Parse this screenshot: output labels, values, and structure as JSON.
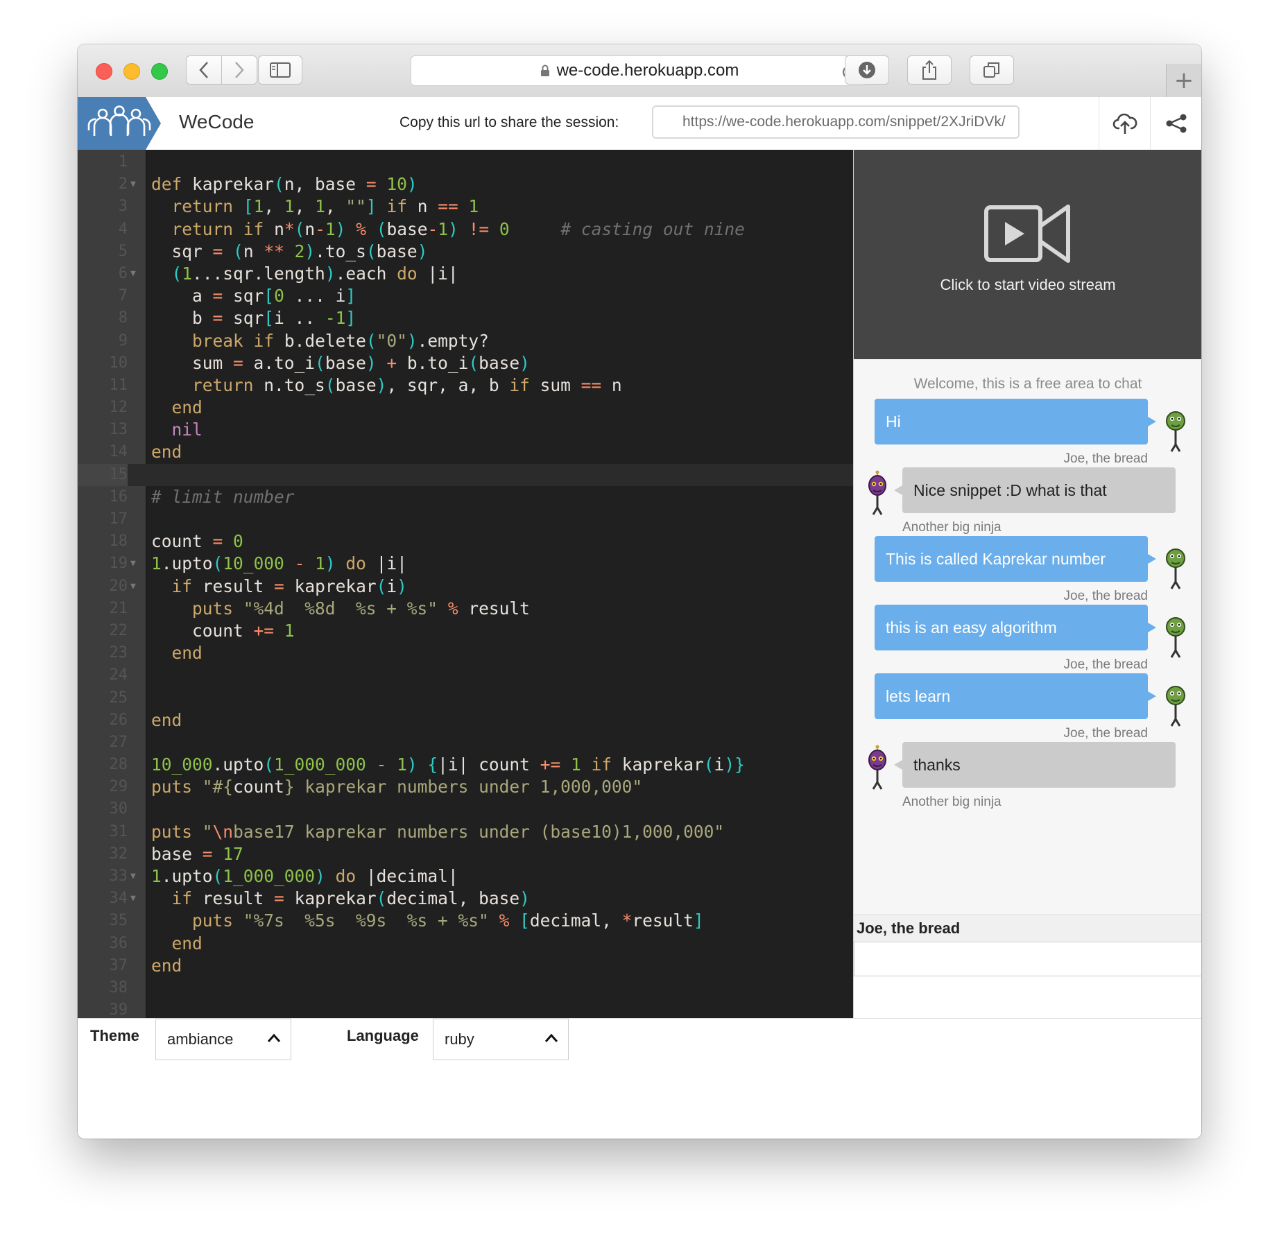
{
  "browser": {
    "url": "we-code.herokuapp.com",
    "new_tab_label": "+"
  },
  "header": {
    "app_name": "WeCode",
    "share_label": "Copy this url to share the session:",
    "share_url": "https://we-code.herokuapp.com/snippet/2XJriDVk/"
  },
  "editor": {
    "active_line": 15,
    "lines": [
      {
        "n": "1",
        "fold": false,
        "html": ""
      },
      {
        "n": "2",
        "fold": true,
        "html": "<span class='kw'>def</span> kaprekar<span class='br'>(</span>n, base <span class='op'>=</span> <span class='num'>10</span><span class='br'>)</span>"
      },
      {
        "n": "3",
        "fold": false,
        "html": "  <span class='kw'>return</span> <span class='br'>[</span><span class='num'>1</span>, <span class='num'>1</span>, <span class='num'>1</span>, <span class='str'>\"\"</span><span class='br'>]</span> <span class='kw'>if</span> n <span class='op'>==</span> <span class='num'>1</span>"
      },
      {
        "n": "4",
        "fold": false,
        "html": "  <span class='kw'>return</span> <span class='kw'>if</span> n<span class='op'>*</span><span class='br'>(</span>n<span class='op'>-</span><span class='num'>1</span><span class='br'>)</span> <span class='op'>%</span> <span class='br'>(</span>base<span class='op'>-</span><span class='num'>1</span><span class='br'>)</span> <span class='op'>!=</span> <span class='num'>0</span>     <span class='cm'># casting out nine</span>"
      },
      {
        "n": "5",
        "fold": false,
        "html": "  sqr <span class='op'>=</span> <span class='br'>(</span>n <span class='op'>**</span> <span class='num'>2</span><span class='br'>)</span>.to_s<span class='br'>(</span>base<span class='br'>)</span>"
      },
      {
        "n": "6",
        "fold": true,
        "html": "  <span class='br'>(</span><span class='num'>1</span>...sqr.length<span class='br'>)</span>.each <span class='kw'>do</span> |i|"
      },
      {
        "n": "7",
        "fold": false,
        "html": "    a <span class='op'>=</span> sqr<span class='br'>[</span><span class='num'>0</span> ... i<span class='br'>]</span>"
      },
      {
        "n": "8",
        "fold": false,
        "html": "    b <span class='op'>=</span> sqr<span class='br'>[</span>i .. <span class='num'>-1</span><span class='br'>]</span>"
      },
      {
        "n": "9",
        "fold": false,
        "html": "    <span class='kw'>break</span> <span class='kw'>if</span> b.delete<span class='br'>(</span><span class='str'>\"0\"</span><span class='br'>)</span>.empty?"
      },
      {
        "n": "10",
        "fold": false,
        "html": "    sum <span class='op'>=</span> a.to_i<span class='br'>(</span>base<span class='br'>)</span> <span class='op'>+</span> b.to_i<span class='br'>(</span>base<span class='br'>)</span>"
      },
      {
        "n": "11",
        "fold": false,
        "html": "    <span class='kw'>return</span> n.to_s<span class='br'>(</span>base<span class='br'>)</span>, sqr, a, b <span class='kw'>if</span> sum <span class='op'>==</span> n"
      },
      {
        "n": "12",
        "fold": false,
        "html": "  <span class='kw'>end</span>"
      },
      {
        "n": "13",
        "fold": false,
        "html": "  <span class='nl'>nil</span>"
      },
      {
        "n": "14",
        "fold": false,
        "html": "<span class='kw'>end</span>"
      },
      {
        "n": "15",
        "fold": false,
        "html": ""
      },
      {
        "n": "16",
        "fold": false,
        "html": "<span class='cm'># limit number</span>"
      },
      {
        "n": "17",
        "fold": false,
        "html": ""
      },
      {
        "n": "18",
        "fold": false,
        "html": "count <span class='op'>=</span> <span class='num'>0</span>"
      },
      {
        "n": "19",
        "fold": true,
        "html": "<span class='num'>1</span>.upto<span class='br'>(</span><span class='num'>10_000</span> <span class='op'>-</span> <span class='num'>1</span><span class='br'>)</span> <span class='kw'>do</span> |i|"
      },
      {
        "n": "20",
        "fold": true,
        "html": "  <span class='kw'>if</span> result <span class='op'>=</span> kaprekar<span class='br'>(</span>i<span class='br'>)</span>"
      },
      {
        "n": "21",
        "fold": false,
        "html": "    <span class='kw'>puts</span> <span class='str'>\"%4d  %8d  %s + %s\"</span> <span class='op'>%</span> result"
      },
      {
        "n": "22",
        "fold": false,
        "html": "    count <span class='op'>+=</span> <span class='num'>1</span>"
      },
      {
        "n": "23",
        "fold": false,
        "html": "  <span class='kw'>end</span>"
      },
      {
        "n": "24",
        "fold": false,
        "html": ""
      },
      {
        "n": "25",
        "fold": false,
        "html": ""
      },
      {
        "n": "26",
        "fold": false,
        "html": "<span class='kw'>end</span>"
      },
      {
        "n": "27",
        "fold": false,
        "html": ""
      },
      {
        "n": "28",
        "fold": false,
        "html": "<span class='num'>10_000</span>.upto<span class='br'>(</span><span class='num'>1_000_000</span> <span class='op'>-</span> <span class='num'>1</span><span class='br'>)</span> <span class='br'>{</span>|i| count <span class='op'>+=</span> <span class='num'>1</span> <span class='kw'>if</span> kaprekar<span class='br'>(</span>i<span class='br'>)}</span>"
      },
      {
        "n": "29",
        "fold": false,
        "html": "<span class='kw'>puts</span> <span class='str'>\"</span><span class='str'>#{</span><span class='interp'>count</span><span class='str'>}</span><span class='str'> kaprekar numbers under 1,000,000\"</span>"
      },
      {
        "n": "30",
        "fold": false,
        "html": ""
      },
      {
        "n": "31",
        "fold": false,
        "html": "<span class='kw'>puts</span> <span class='str'>\"</span><span class='op'>\\n</span><span class='str'>base17 kaprekar numbers under (base10)1,000,000\"</span>"
      },
      {
        "n": "32",
        "fold": false,
        "html": "base <span class='op'>=</span> <span class='num'>17</span>"
      },
      {
        "n": "33",
        "fold": true,
        "html": "<span class='num'>1</span>.upto<span class='br'>(</span><span class='num'>1_000_000</span><span class='br'>)</span> <span class='kw'>do</span> |decimal|"
      },
      {
        "n": "34",
        "fold": true,
        "html": "  <span class='kw'>if</span> result <span class='op'>=</span> kaprekar<span class='br'>(</span>decimal, base<span class='br'>)</span>"
      },
      {
        "n": "35",
        "fold": false,
        "html": "    <span class='kw'>puts</span> <span class='str'>\"%7s  %5s  %9s  %s + %s\"</span> <span class='op'>%</span> <span class='br'>[</span>decimal, <span class='op'>*</span>result<span class='br'>]</span>"
      },
      {
        "n": "36",
        "fold": false,
        "html": "  <span class='kw'>end</span>"
      },
      {
        "n": "37",
        "fold": false,
        "html": "<span class='kw'>end</span>"
      },
      {
        "n": "38",
        "fold": false,
        "html": ""
      },
      {
        "n": "39",
        "fold": false,
        "html": ""
      }
    ]
  },
  "video": {
    "label": "Click to start video stream"
  },
  "chat": {
    "welcome": "Welcome, this is a free area to chat",
    "messages": [
      {
        "side": "me",
        "text": "Hi",
        "author": "Joe, the bread"
      },
      {
        "side": "them",
        "text": "Nice snippet :D what is that",
        "author": "Another big ninja"
      },
      {
        "side": "me",
        "text": "This is called Kaprekar number",
        "author": "Joe, the bread"
      },
      {
        "side": "me",
        "text": "this is an easy algorithm",
        "author": "Joe, the bread"
      },
      {
        "side": "me",
        "text": "lets learn",
        "author": "Joe, the bread"
      },
      {
        "side": "them",
        "text": "thanks",
        "author": "Another big ninja"
      }
    ],
    "current_user": "Joe, the bread",
    "input_value": ""
  },
  "footer": {
    "theme_label": "Theme",
    "theme_value": "ambiance",
    "language_label": "Language",
    "language_value": "ruby"
  },
  "colors": {
    "user_bubble": "#6aaeeb",
    "other_bubble": "#cbcbcb",
    "logo_blue": "#4a7fb5",
    "editor_bg": "#202020"
  }
}
